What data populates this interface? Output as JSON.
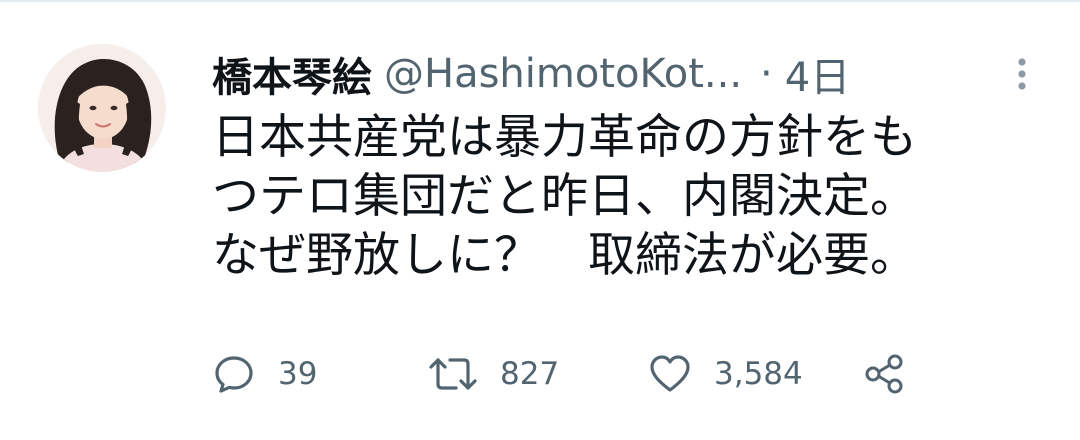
{
  "tweet": {
    "author": {
      "display_name": "橋本琴絵",
      "handle": "@HashimotoKot...",
      "avatar_icon": "user-avatar"
    },
    "separator": "·",
    "time": "4日",
    "text_lines": [
      "日本共産党は暴力革命の方針をも",
      "つテロ集団だと昨日、内閣決定。",
      "なぜ野放しに？　取締法が必要。"
    ],
    "more_icon": "vertical-dots-icon",
    "actions": {
      "reply": {
        "icon": "speech-bubble-icon",
        "count": "39"
      },
      "retweet": {
        "icon": "retweet-icon",
        "count": "827"
      },
      "like": {
        "icon": "heart-icon",
        "count": "3,584"
      },
      "share": {
        "icon": "share-icon"
      }
    }
  },
  "colors": {
    "text_primary": "#0f1419",
    "text_secondary": "#536471",
    "divider": "#e6ecf0"
  }
}
